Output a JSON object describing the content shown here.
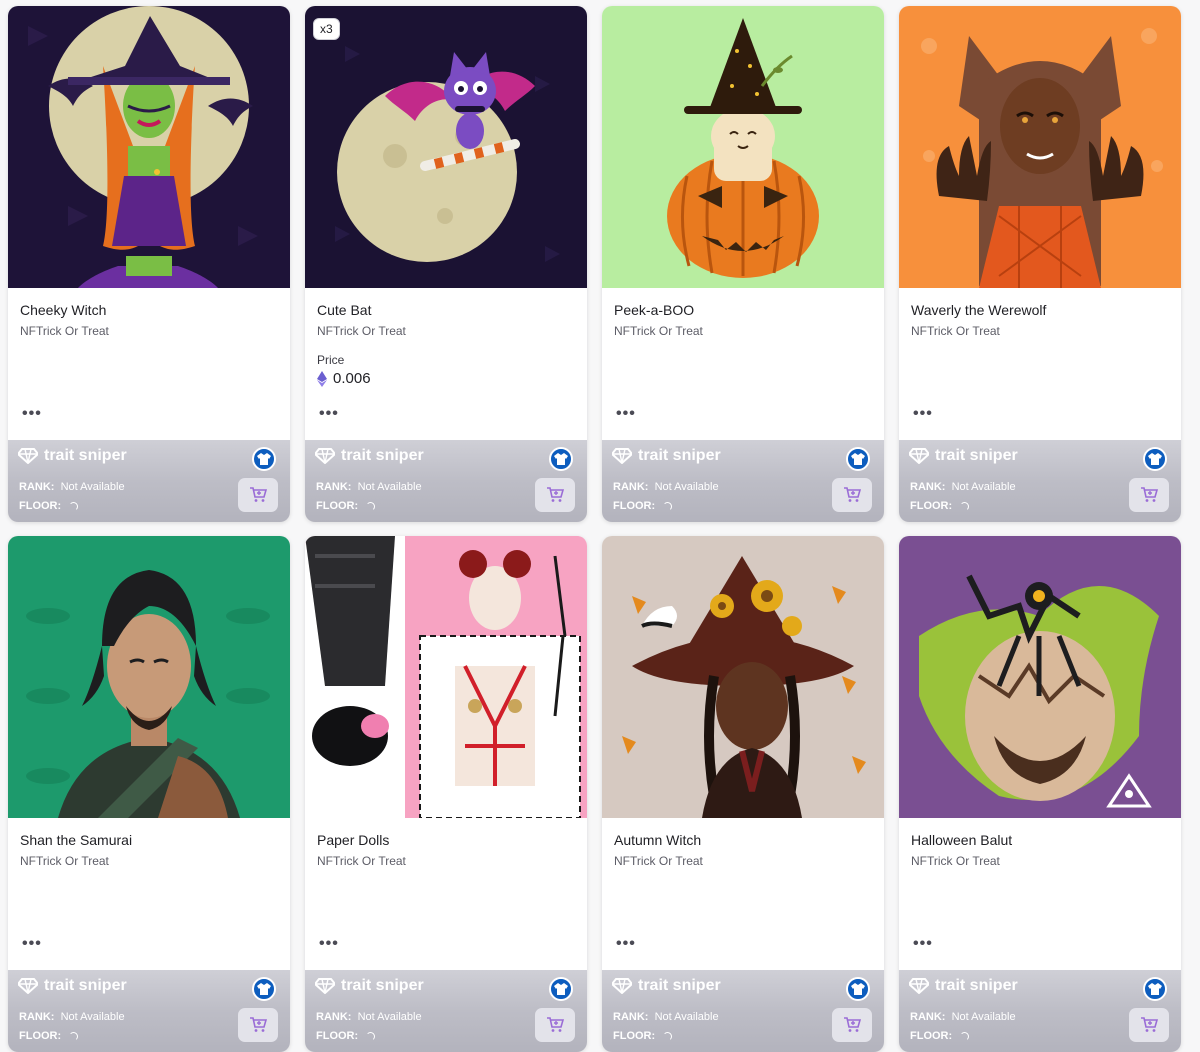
{
  "sniper": {
    "brand": "trait sniper",
    "rank_label": "RANK:",
    "rank_value": "Not Available",
    "floor_label": "FLOOR:"
  },
  "more_label": "•••",
  "price_label": "Price",
  "cards": [
    {
      "title": "Cheeky Witch",
      "collection": "NFTrick Or Treat"
    },
    {
      "title": "Cute Bat",
      "collection": "NFTrick Or Treat",
      "quantity": "x3",
      "price": "0.006"
    },
    {
      "title": "Peek-a-BOO",
      "collection": "NFTrick Or Treat"
    },
    {
      "title": "Waverly the Werewolf",
      "collection": "NFTrick Or Treat"
    },
    {
      "title": "Shan the Samurai",
      "collection": "NFTrick Or Treat"
    },
    {
      "title": "Paper Dolls",
      "collection": "NFTrick Or Treat"
    },
    {
      "title": "Autumn Witch",
      "collection": "NFTrick Or Treat"
    },
    {
      "title": "Halloween Balut",
      "collection": "NFTrick Or Treat"
    }
  ],
  "colors": {
    "shirt_button": "#0d5dbe",
    "cart_icon": "#9a6cd6",
    "sniper_band": "#bdbdc6"
  },
  "icons": [
    "diamond-icon",
    "shirt-icon",
    "cart-icon",
    "ethereum-icon",
    "more-icon"
  ]
}
